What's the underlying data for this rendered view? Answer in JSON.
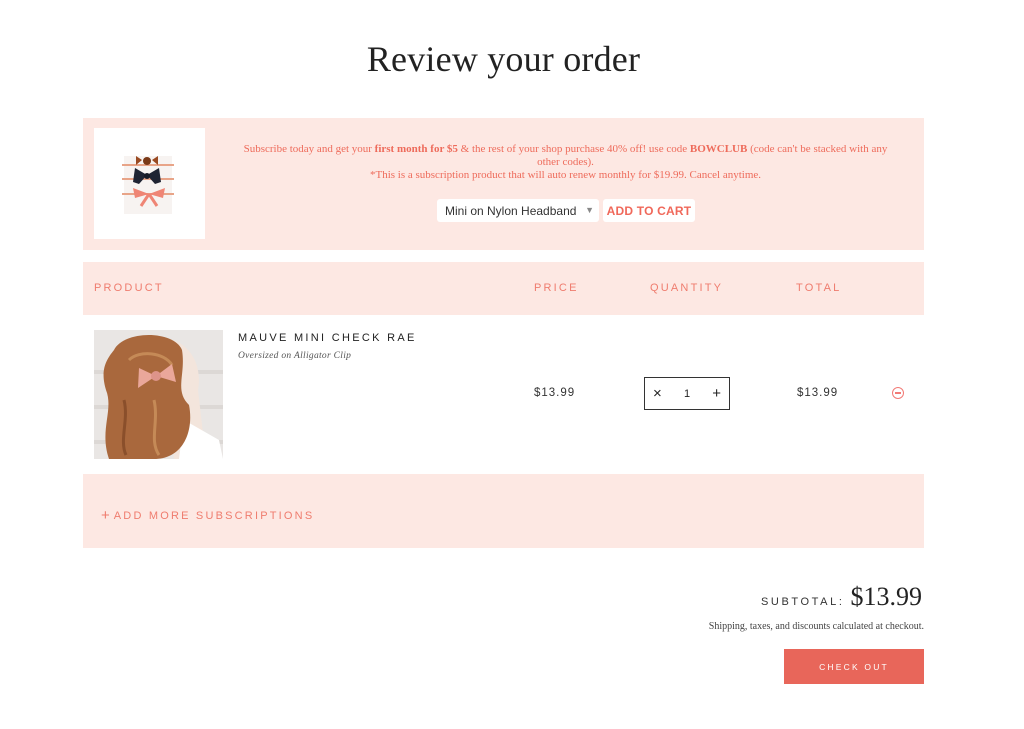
{
  "page": {
    "title": "Review your order"
  },
  "promo": {
    "line1_pre": "Subscribe today and get your ",
    "line1_bold1": "first month for $5",
    "line1_mid": " & the rest of your shop purchase 40% off! use code ",
    "line1_bold2": "BOWCLUB",
    "line1_post": " (code can't be stacked with any other codes).",
    "line2": "*This is a subscription product that will auto renew monthly for $19.99. Cancel anytime.",
    "variant_selected": "Mini on Nylon Headband",
    "add_to_cart_label": "ADD TO CART",
    "image_alt": "bow headband set"
  },
  "table": {
    "headers": {
      "product": "PRODUCT",
      "price": "PRICE",
      "quantity": "QUANTITY",
      "total": "TOTAL"
    },
    "items": [
      {
        "name": "MAUVE MINI CHECK RAE",
        "variant": "Oversized on Alligator Clip",
        "price": "$13.99",
        "quantity": "1",
        "total": "$13.99",
        "image_alt": "girl with pink bow in hair"
      }
    ]
  },
  "add_more": {
    "label": "ADD MORE SUBSCRIPTIONS",
    "icon": "plus-icon"
  },
  "summary": {
    "subtotal_label": "SUBTOTAL:",
    "subtotal_value": "$13.99",
    "shipping_note": "Shipping, taxes, and discounts calculated at checkout.",
    "checkout_label": "CHECK OUT"
  },
  "colors": {
    "accent": "#e8665a",
    "panel": "#fde8e3",
    "accent_text": "#ef7c6e"
  }
}
